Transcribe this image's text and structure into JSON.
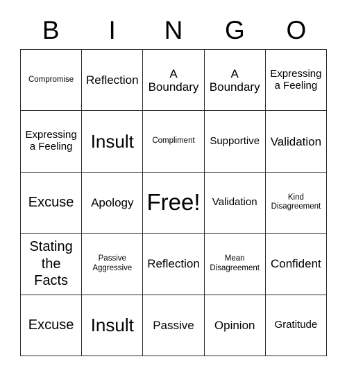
{
  "card": {
    "title": "BINGO",
    "header_letters": [
      "B",
      "I",
      "N",
      "G",
      "O"
    ],
    "grid_size": "5x5",
    "free_space": "Free!",
    "colors": {
      "background": "#ffffff",
      "text": "#000000",
      "border": "#2a2a2a"
    },
    "cells": [
      {
        "text": "Compromise",
        "size": "fs-xs"
      },
      {
        "text": "Reflection",
        "size": "fs-md"
      },
      {
        "text": "A\nBoundary",
        "size": "fs-md"
      },
      {
        "text": "A\nBoundary",
        "size": "fs-md"
      },
      {
        "text": "Expressing\na Feeling",
        "size": "fs-sm"
      },
      {
        "text": "Expressing\na Feeling",
        "size": "fs-sm"
      },
      {
        "text": "Insult",
        "size": "fs-xl"
      },
      {
        "text": "Compliment",
        "size": "fs-xs"
      },
      {
        "text": "Supportive",
        "size": "fs-sm"
      },
      {
        "text": "Validation",
        "size": "fs-md"
      },
      {
        "text": "Excuse",
        "size": "fs-lg"
      },
      {
        "text": "Apology",
        "size": "fs-md"
      },
      {
        "text": "Free!",
        "size": "fs-xxl"
      },
      {
        "text": "Validation",
        "size": "fs-sm"
      },
      {
        "text": "Kind\nDisagreement",
        "size": "fs-xs"
      },
      {
        "text": "Stating\nthe\nFacts",
        "size": "fs-lg"
      },
      {
        "text": "Passive\nAggressive",
        "size": "fs-xs"
      },
      {
        "text": "Reflection",
        "size": "fs-md"
      },
      {
        "text": "Mean\nDisagreement",
        "size": "fs-xs"
      },
      {
        "text": "Confident",
        "size": "fs-md"
      },
      {
        "text": "Excuse",
        "size": "fs-lg"
      },
      {
        "text": "Insult",
        "size": "fs-xl"
      },
      {
        "text": "Passive",
        "size": "fs-md"
      },
      {
        "text": "Opinion",
        "size": "fs-md"
      },
      {
        "text": "Gratitude",
        "size": "fs-sm"
      }
    ]
  }
}
